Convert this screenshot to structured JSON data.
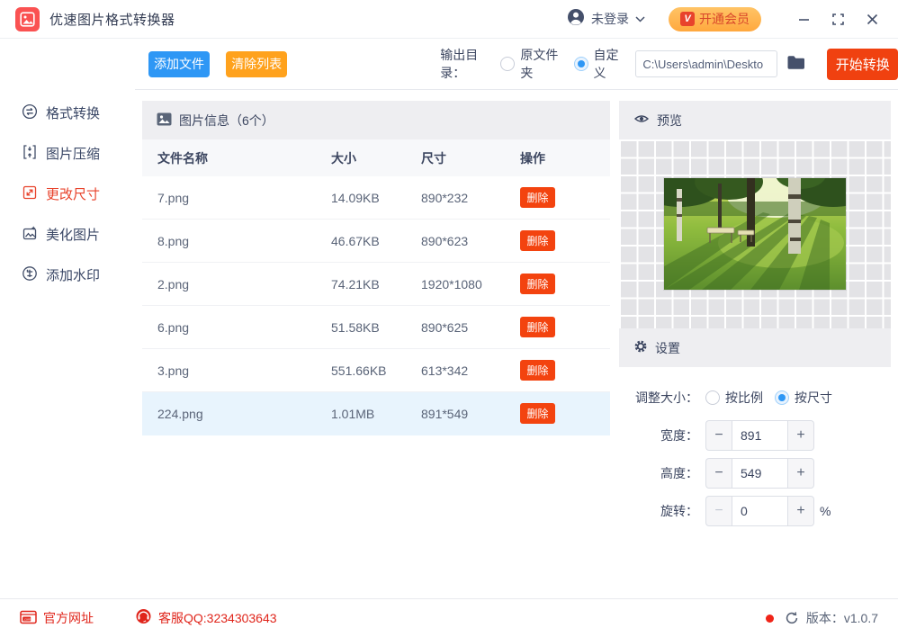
{
  "titlebar": {
    "app_title": "优速图片格式转换器",
    "login_status": "未登录",
    "vip_badge": "V",
    "vip_label": "开通会员"
  },
  "toolbar": {
    "add_files": "添加文件",
    "clear_list": "清除列表",
    "output_dir_label": "输出目录：",
    "radio_original_folder": "原文件夹",
    "radio_custom": "自定义",
    "output_path": "C:\\Users\\admin\\Deskto",
    "start_convert": "开始转换"
  },
  "sidebar": {
    "items": [
      {
        "label": "格式转换",
        "active": false
      },
      {
        "label": "图片压缩",
        "active": false
      },
      {
        "label": "更改尺寸",
        "active": true
      },
      {
        "label": "美化图片",
        "active": false
      },
      {
        "label": "添加水印",
        "active": false
      }
    ]
  },
  "file_panel": {
    "header": "图片信息（6个）",
    "columns": {
      "name": "文件名称",
      "size": "大小",
      "dims": "尺寸",
      "action": "操作"
    },
    "delete_label": "删除",
    "rows": [
      {
        "name": "7.png",
        "size": "14.09KB",
        "dims": "890*232"
      },
      {
        "name": "8.png",
        "size": "46.67KB",
        "dims": "890*623"
      },
      {
        "name": "2.png",
        "size": "74.21KB",
        "dims": "1920*1080"
      },
      {
        "name": "6.png",
        "size": "51.58KB",
        "dims": "890*625"
      },
      {
        "name": "3.png",
        "size": "551.66KB",
        "dims": "613*342"
      },
      {
        "name": "224.png",
        "size": "1.01MB",
        "dims": "891*549"
      }
    ],
    "selected_row": "224.png"
  },
  "preview_panel": {
    "header": "预览"
  },
  "settings_panel": {
    "header": "设置",
    "resize_label": "调整大小：",
    "radio_ratio": "按比例",
    "radio_size": "按尺寸",
    "width_label": "宽度：",
    "width_value": "891",
    "height_label": "高度：",
    "height_value": "549",
    "rotate_label": "旋转：",
    "rotate_value": "0",
    "rotate_suffix": "%",
    "minus_glyph": "−",
    "plus_glyph": "+"
  },
  "footer": {
    "website": "官方网址",
    "qq": "客服QQ:3234303643",
    "version": "版本：v1.0.7"
  },
  "colors": {
    "accent_blue": "#2e97f5",
    "accent_orange": "#ffa21d",
    "accent_red": "#f04110",
    "vip_gradient": "#ffc466-#ffa83e",
    "active_menu_red": "#e8432c",
    "selected_row_bg": "#e8f4fd",
    "panel_header_bg": "#eeeef1",
    "footer_red": "#e0251b"
  }
}
